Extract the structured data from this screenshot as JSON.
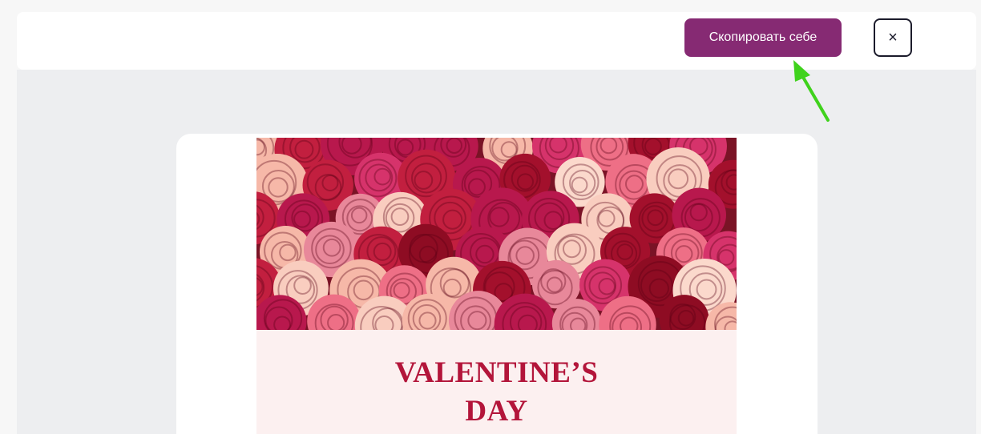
{
  "toolbar": {
    "copy_label": "Скопировать себе",
    "close_label": "×",
    "accent_color": "#862a73"
  },
  "preview": {
    "hero_image": "roses-bouquet-photo",
    "title_lines": [
      "VALENTINE’S",
      "DAY"
    ],
    "title_color": "#b3153a"
  },
  "annotation": {
    "arrow_icon": "green-pointer-arrow",
    "arrow_color": "#3fd21c"
  }
}
